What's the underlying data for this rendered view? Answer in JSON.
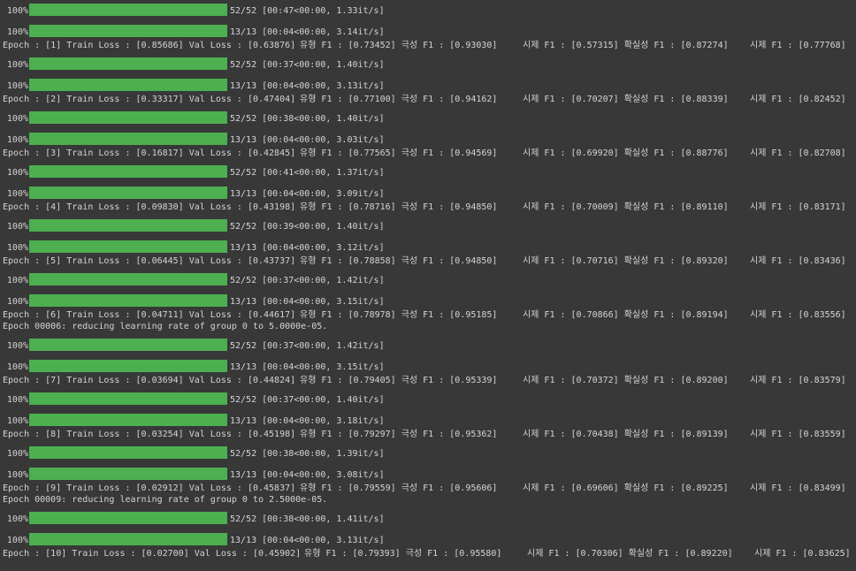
{
  "progress_rows": [
    {
      "pct": "100%",
      "fill": 1.0,
      "stat": "52/52 [00:47<00:00, 1.33it/s]"
    },
    {
      "pct": "100%",
      "fill": 1.0,
      "stat": "13/13 [00:04<00:00, 3.14it/s]"
    },
    {
      "pct": "100%",
      "fill": 1.0,
      "stat": "52/52 [00:37<00:00, 1.40it/s]"
    },
    {
      "pct": "100%",
      "fill": 1.0,
      "stat": "13/13 [00:04<00:00, 3.13it/s]"
    },
    {
      "pct": "100%",
      "fill": 1.0,
      "stat": "52/52 [00:38<00:00, 1.40it/s]"
    },
    {
      "pct": "100%",
      "fill": 1.0,
      "stat": "13/13 [00:04<00:00, 3.03it/s]"
    },
    {
      "pct": "100%",
      "fill": 1.0,
      "stat": "52/52 [00:41<00:00, 1.37it/s]"
    },
    {
      "pct": "100%",
      "fill": 1.0,
      "stat": "13/13 [00:04<00:00, 3.09it/s]"
    },
    {
      "pct": "100%",
      "fill": 1.0,
      "stat": "52/52 [00:39<00:00, 1.40it/s]"
    },
    {
      "pct": "100%",
      "fill": 1.0,
      "stat": "13/13 [00:04<00:00, 3.12it/s]"
    },
    {
      "pct": "100%",
      "fill": 1.0,
      "stat": "52/52 [00:37<00:00, 1.42it/s]"
    },
    {
      "pct": "100%",
      "fill": 1.0,
      "stat": "13/13 [00:04<00:00, 3.15it/s]"
    },
    {
      "pct": "100%",
      "fill": 1.0,
      "stat": "52/52 [00:37<00:00, 1.42it/s]"
    },
    {
      "pct": "100%",
      "fill": 1.0,
      "stat": "13/13 [00:04<00:00, 3.15it/s]"
    },
    {
      "pct": "100%",
      "fill": 1.0,
      "stat": "52/52 [00:37<00:00, 1.40it/s]"
    },
    {
      "pct": "100%",
      "fill": 1.0,
      "stat": "13/13 [00:04<00:00, 3.18it/s]"
    },
    {
      "pct": "100%",
      "fill": 1.0,
      "stat": "52/52 [00:38<00:00, 1.39it/s]"
    },
    {
      "pct": "100%",
      "fill": 1.0,
      "stat": "13/13 [00:04<00:00, 3.08it/s]"
    },
    {
      "pct": "100%",
      "fill": 1.0,
      "stat": "52/52 [00:38<00:00, 1.41it/s]"
    },
    {
      "pct": "100%",
      "fill": 1.0,
      "stat": "13/13 [00:04<00:00, 3.13it/s]"
    }
  ],
  "epoch_rows": [
    {
      "main": "Epoch : [1] Train Loss : [0.85686] Val Loss : [0.63876]",
      "type_f1": "유형 F1 : [0.73452] 극성 F1 : [0.93030]",
      "tense_f1": "시제 F1 : [0.57315] 확실성 F1 : [0.87274]",
      "total_f1": "시제 F1 : [0.77768]"
    },
    {
      "main": "Epoch : [2] Train Loss : [0.33317] Val Loss : [0.47404]",
      "type_f1": "유형 F1 : [0.77100] 극성 F1 : [0.94162]",
      "tense_f1": "시제 F1 : [0.70207] 확실성 F1 : [0.88339]",
      "total_f1": "시제 F1 : [0.82452]"
    },
    {
      "main": "Epoch : [3] Train Loss : [0.16817] Val Loss : [0.42845]",
      "type_f1": "유형 F1 : [0.77565] 극성 F1 : [0.94569]",
      "tense_f1": "시제 F1 : [0.69920] 확실성 F1 : [0.88776]",
      "total_f1": "시제 F1 : [0.82708]"
    },
    {
      "main": "Epoch : [4] Train Loss : [0.09830] Val Loss : [0.43198]",
      "type_f1": "유형 F1 : [0.78716] 극성 F1 : [0.94850]",
      "tense_f1": "시제 F1 : [0.70009] 확실성 F1 : [0.89110]",
      "total_f1": "시제 F1 : [0.83171]"
    },
    {
      "main": "Epoch : [5] Train Loss : [0.06445] Val Loss : [0.43737]",
      "type_f1": "유형 F1 : [0.78858] 극성 F1 : [0.94850]",
      "tense_f1": "시제 F1 : [0.70716] 확실성 F1 : [0.89320]",
      "total_f1": "시제 F1 : [0.83436]"
    },
    {
      "main": "Epoch : [6] Train Loss : [0.04711] Val Loss : [0.44617]",
      "type_f1": "유형 F1 : [0.78978] 극성 F1 : [0.95185]",
      "tense_f1": "시제 F1 : [0.70866] 확실성 F1 : [0.89194]",
      "total_f1": "시제 F1 : [0.83556]"
    },
    {
      "main": "Epoch : [7] Train Loss : [0.03694] Val Loss : [0.44824]",
      "type_f1": "유형 F1 : [0.79405] 극성 F1 : [0.95339]",
      "tense_f1": "시제 F1 : [0.70372] 확실성 F1 : [0.89200]",
      "total_f1": "시제 F1 : [0.83579]"
    },
    {
      "main": "Epoch : [8] Train Loss : [0.03254] Val Loss : [0.45198]",
      "type_f1": "유형 F1 : [0.79297] 극성 F1 : [0.95362]",
      "tense_f1": "시제 F1 : [0.70438] 확실성 F1 : [0.89139]",
      "total_f1": "시제 F1 : [0.83559]"
    },
    {
      "main": "Epoch : [9] Train Loss : [0.02912] Val Loss : [0.45837]",
      "type_f1": "유형 F1 : [0.79559] 극성 F1 : [0.95606]",
      "tense_f1": "시제 F1 : [0.69606] 확실성 F1 : [0.89225]",
      "total_f1": "시제 F1 : [0.83499]"
    },
    {
      "main": "Epoch : [10] Train Loss : [0.02700] Val Loss : [0.45902]",
      "type_f1": "유형 F1 : [0.79393] 극성 F1 : [0.95580]",
      "tense_f1": "시제 F1 : [0.70306] 확실성 F1 : [0.89220]",
      "total_f1": "시제 F1 : [0.83625]"
    }
  ],
  "notices": [
    "Epoch 00006: reducing learning rate of group 0 to 5.0000e-05.",
    "Epoch 00009: reducing learning rate of group 0 to 2.5000e-05."
  ],
  "colors": {
    "background": "#383838",
    "text": "#d4d4d4",
    "bar_fill": "#4caf50",
    "bar_track": "#555555"
  }
}
